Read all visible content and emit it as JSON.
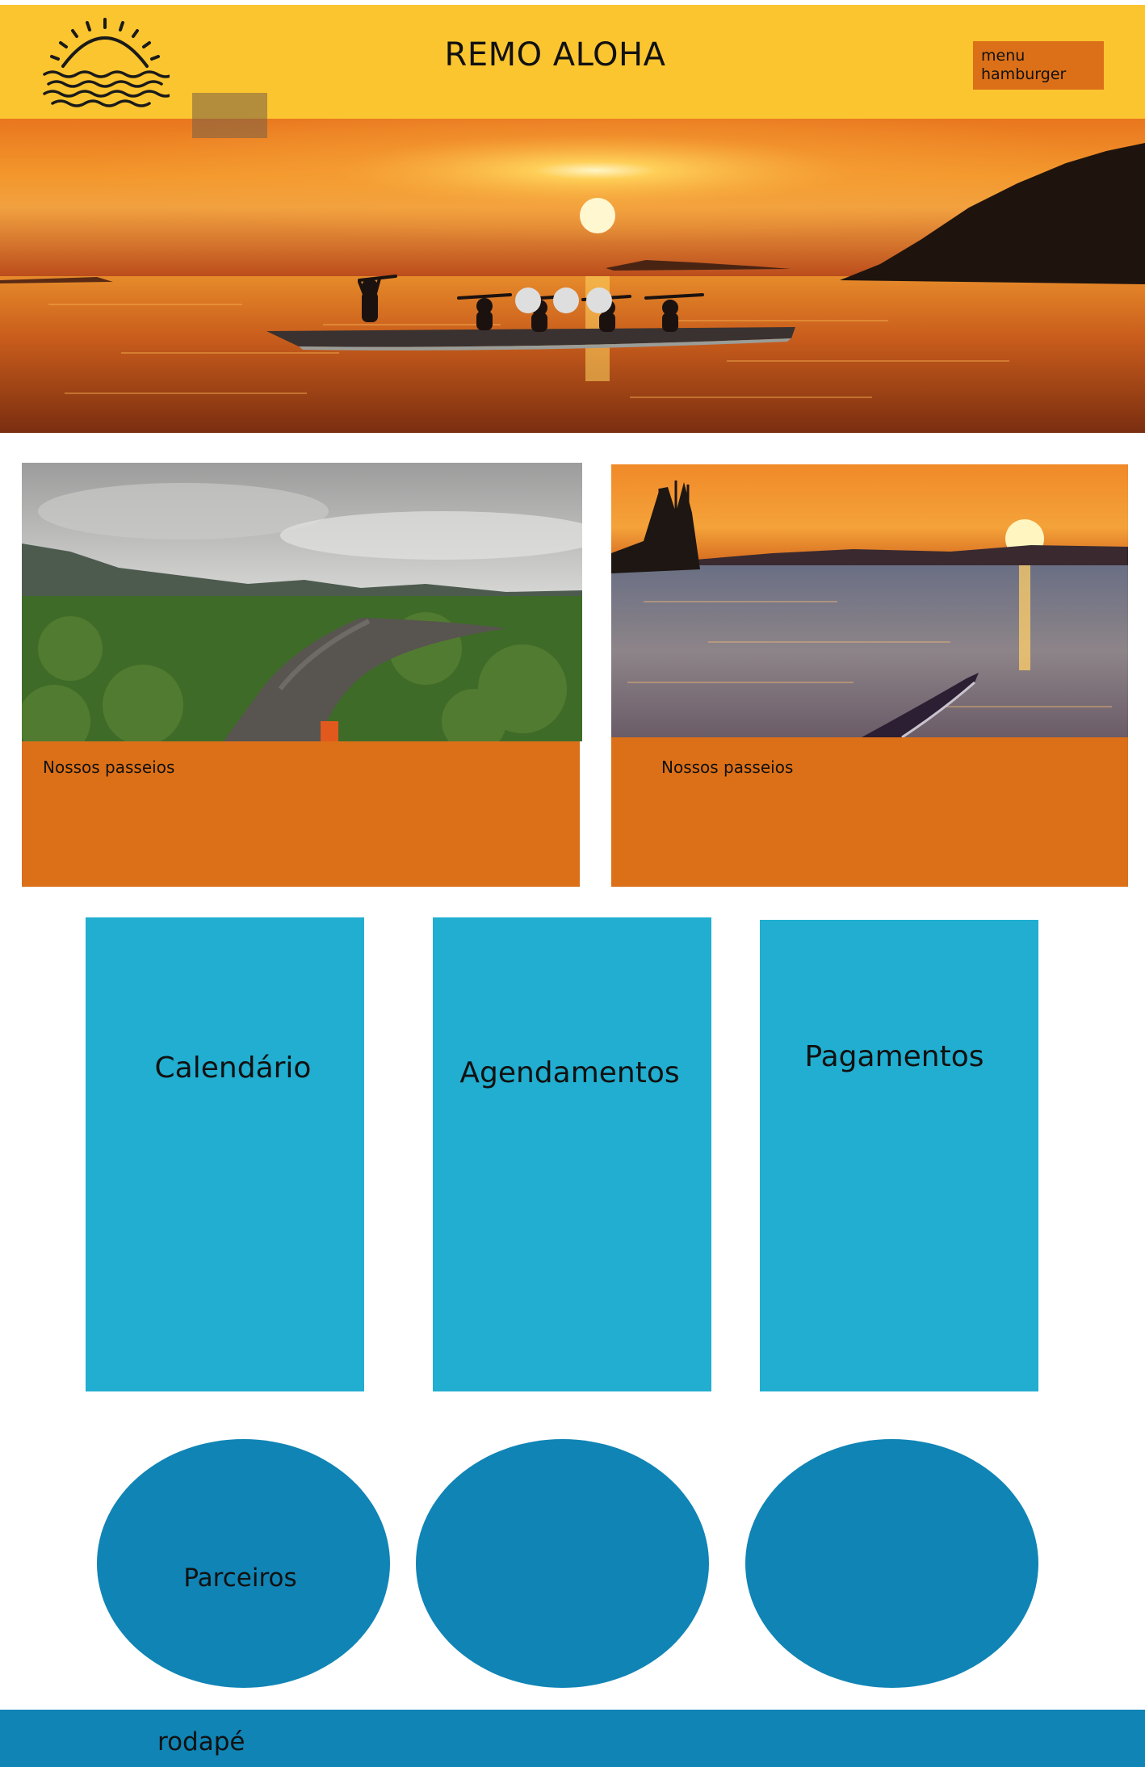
{
  "header": {
    "logo_icon": "sunset-over-waves-logo",
    "title": "REMO ALOHA",
    "menu_label": "menu hamburger"
  },
  "hero": {
    "image": "outrigger-canoe-team-at-sunset",
    "slides": 3
  },
  "cards": [
    {
      "image": "mangrove-river-aerial",
      "label": "Nossos passeios"
    },
    {
      "image": "kayak-sunset-harbor",
      "label": "Nossos passeios"
    }
  ],
  "boxes": [
    {
      "label": "Calendário"
    },
    {
      "label": "Agendamentos"
    },
    {
      "label": "Pagamentos"
    }
  ],
  "circles": [
    {
      "label": "Parceiros"
    },
    {
      "label": ""
    },
    {
      "label": ""
    }
  ],
  "footer": {
    "label": "rodapé"
  },
  "colors": {
    "header": "#fbc52f",
    "accent_orange": "#dc7018",
    "box_blue": "#21aed0",
    "circle_blue": "#1084b5"
  }
}
